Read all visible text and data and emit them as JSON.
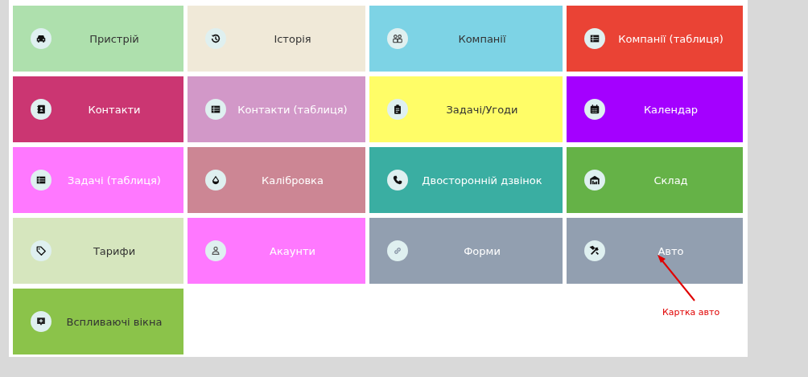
{
  "tiles": [
    {
      "label": "Пристрій",
      "color": "#aee0ad",
      "kind": "pale"
    },
    {
      "label": "Історія",
      "color": "#f0e9d8",
      "kind": "pale"
    },
    {
      "label": "Компанії",
      "color": "#7dd3e5",
      "kind": "pale"
    },
    {
      "label": "Компанії (таблиця)",
      "color": "#ea4335",
      "kind": "vivid"
    },
    {
      "label": "Контакти",
      "color": "#cb3672",
      "kind": "vivid"
    },
    {
      "label": "Контакти (таблиця)",
      "color": "#d298c8",
      "kind": "vivid"
    },
    {
      "label": "Задачі/Угоди",
      "color": "#fffd67",
      "kind": "pale"
    },
    {
      "label": "Календар",
      "color": "#a400ff",
      "kind": "vivid"
    },
    {
      "label": "Задачі (таблиця)",
      "color": "#ff78ff",
      "kind": "vivid"
    },
    {
      "label": "Калібровка",
      "color": "#cc8694",
      "kind": "vivid"
    },
    {
      "label": "Двосторонній дзвінок",
      "color": "#3aaea2",
      "kind": "vivid"
    },
    {
      "label": "Склад",
      "color": "#65b247",
      "kind": "vivid"
    },
    {
      "label": "Тарифи",
      "color": "#d6e6be",
      "kind": "pale"
    },
    {
      "label": "Акаунти",
      "color": "#ff78ff",
      "kind": "vivid"
    },
    {
      "label": "Форми",
      "color": "#929fb0",
      "kind": "vivid"
    },
    {
      "label": "Авто",
      "color": "#929fb0",
      "kind": "vivid"
    },
    {
      "label": "Вспливаючі вікна",
      "color": "#8bc34a",
      "kind": "pale"
    }
  ],
  "annotation": {
    "text": "Картка авто"
  }
}
